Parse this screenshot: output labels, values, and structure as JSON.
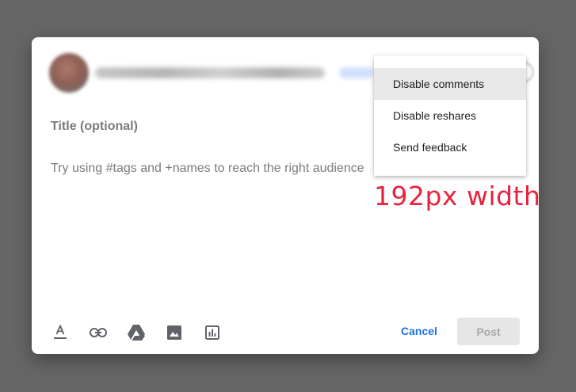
{
  "dialog": {
    "title_placeholder": "Title (optional)",
    "body_placeholder": "Try using #tags and +names to reach the right audience"
  },
  "toolbar": {
    "icons": [
      "text-format-icon",
      "link-icon",
      "drive-icon",
      "image-icon",
      "poll-icon"
    ]
  },
  "actions": {
    "cancel_label": "Cancel",
    "post_label": "Post"
  },
  "menu": {
    "items": [
      {
        "label": "Disable comments",
        "highlighted": true
      },
      {
        "label": "Disable reshares",
        "highlighted": false
      },
      {
        "label": "Send feedback",
        "highlighted": false
      }
    ]
  },
  "annotation": {
    "text": "192px width"
  },
  "colors": {
    "overlay": "#666666",
    "accent": "#1a73e8",
    "annotation": "#e8223f",
    "menu_highlight": "#e8e8e8"
  }
}
